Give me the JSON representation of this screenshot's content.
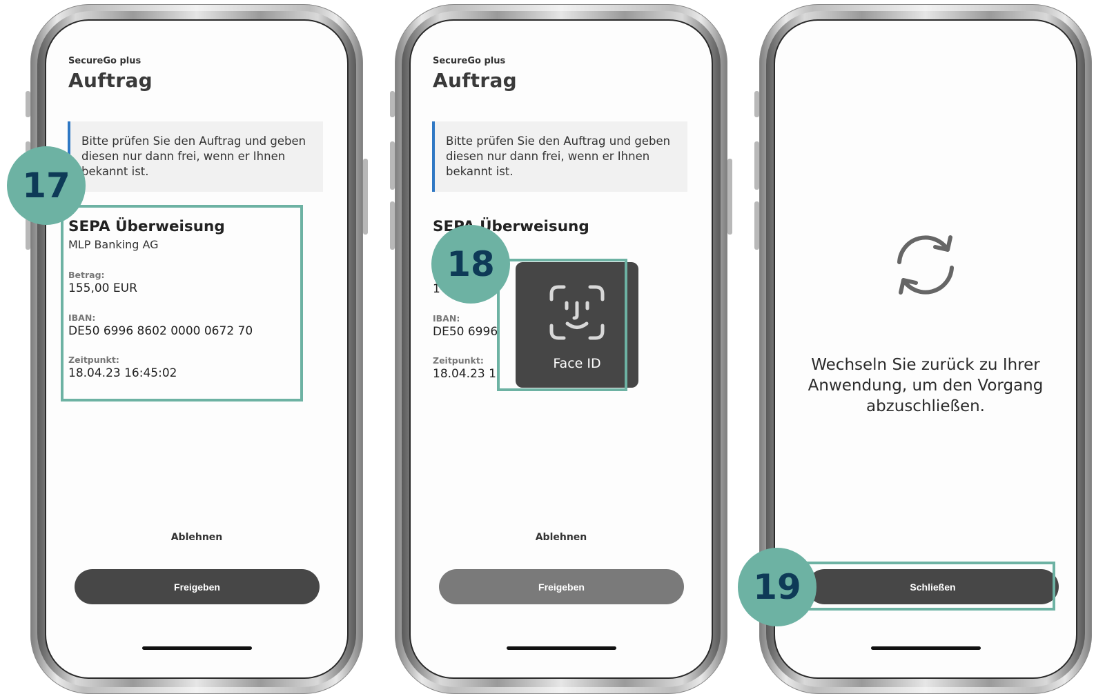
{
  "screens": [
    {
      "app_name": "SecureGo plus",
      "title": "Auftrag",
      "notice": "Bitte prüfen Sie den Auftrag und geben diesen nur dann frei, wenn er Ihnen bekannt ist.",
      "order_title": "SEPA Überweisung",
      "bank": "MLP Banking AG",
      "amount_label": "Betrag:",
      "amount_value": "155,00 EUR",
      "iban_label": "IBAN:",
      "iban_value": "DE50 6996 8602 0000 0672 70",
      "time_label": "Zeitpunkt:",
      "time_value": "18.04.23   16:45:02",
      "decline_label": "Ablehnen",
      "approve_label": "Freigeben",
      "step": "17"
    },
    {
      "app_name": "SecureGo plus",
      "title": "Auftrag",
      "notice": "Bitte prüfen Sie den Auftrag und geben diesen nur dann frei, wenn er Ihnen bekannt ist.",
      "order_title_visible": "SEPA Überweisung",
      "bank_visible": "AG",
      "amount_visible": "1",
      "iban_label": "IBAN:",
      "iban_value_visible": "DE50 6996",
      "time_label": "Zeitpunkt:",
      "time_value_visible": "18.04.23   1",
      "faceid_label": "Face ID",
      "decline_label": "Ablehnen",
      "approve_label": "Freigeben",
      "step": "18"
    },
    {
      "message": "Wechseln Sie zurück zu Ihrer Anwendung, um den Vorgang abzuschließen.",
      "close_label": "Schließen",
      "step": "19"
    }
  ],
  "colors": {
    "highlight": "#6db2a3",
    "step_text": "#0e3a57",
    "notice_accent": "#2f78c4",
    "button": "#474747",
    "button_disabled": "#7a7a7a",
    "faceid_bg": "#464646"
  },
  "icons": [
    "face-id-icon",
    "sync-icon"
  ]
}
